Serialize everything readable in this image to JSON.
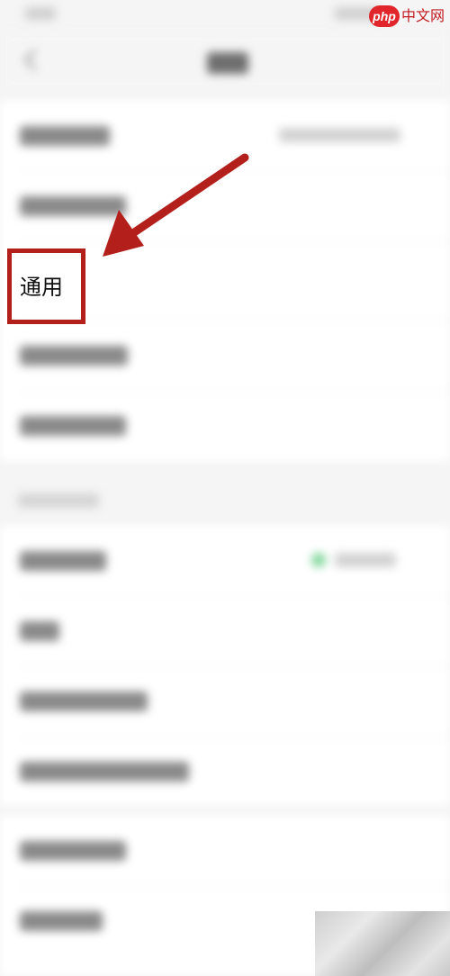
{
  "settings_list": {
    "focused_row_label": "通用"
  },
  "annotation": {
    "highlight_color": "#b3201c"
  },
  "watermark": {
    "badge": "php",
    "text": "中文网"
  }
}
